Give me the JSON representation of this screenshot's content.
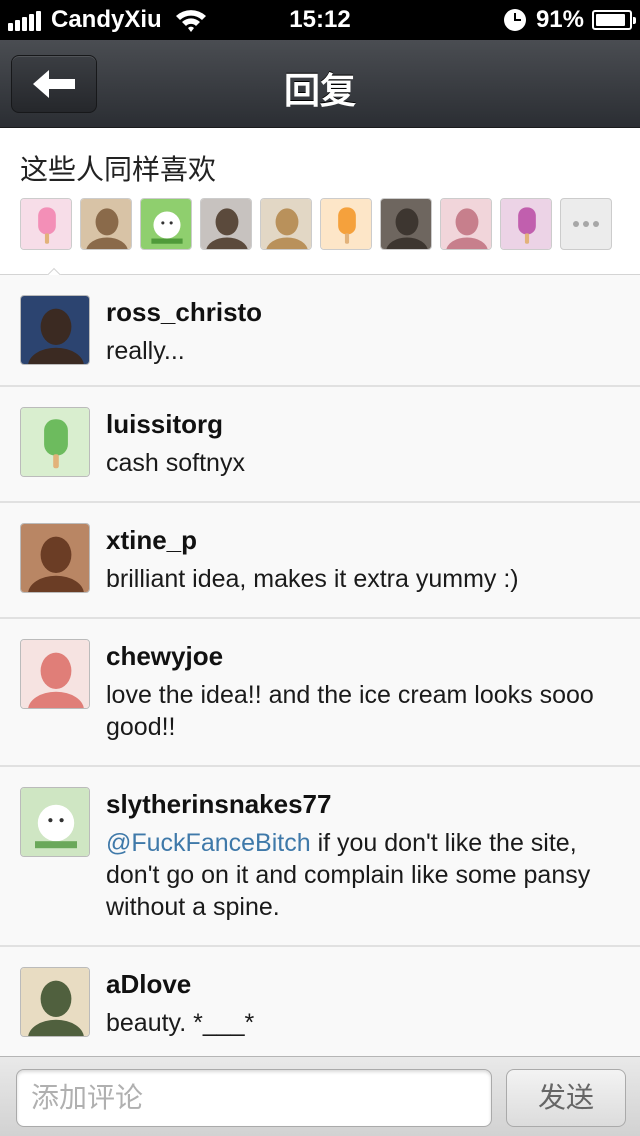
{
  "status_bar": {
    "carrier": "CandyXiu",
    "time": "15:12",
    "battery_text": "91%",
    "battery_level": 0.91
  },
  "nav": {
    "title": "回复",
    "back_icon": "back-arrow-icon"
  },
  "likes": {
    "title": "这些人同样喜欢",
    "avatars": [
      {
        "kind": "popsicle",
        "color": "#f38fb7",
        "bg": "#f7dde8"
      },
      {
        "kind": "photo",
        "color": "#8a6a4a",
        "bg": "#d8c3a6"
      },
      {
        "kind": "cartoon",
        "color": "#4f9a3a",
        "bg": "#8fcf6e"
      },
      {
        "kind": "photo",
        "color": "#5b4a3c",
        "bg": "#c7c2bf"
      },
      {
        "kind": "photo",
        "color": "#b9915b",
        "bg": "#e2d7c5"
      },
      {
        "kind": "popsicle",
        "color": "#f5a13c",
        "bg": "#fde6c8"
      },
      {
        "kind": "photo",
        "color": "#3d3630",
        "bg": "#6e665f"
      },
      {
        "kind": "photo",
        "color": "#c77f8c",
        "bg": "#f1d5da"
      },
      {
        "kind": "popsicle",
        "color": "#c15fae",
        "bg": "#ecd3e6"
      }
    ],
    "more_icon": "more-dots-icon"
  },
  "comments": [
    {
      "user": "ross_christo",
      "mention": "",
      "text": "really...",
      "avatar": {
        "kind": "photo",
        "color": "#3b2a22",
        "bg": "#2c4470"
      }
    },
    {
      "user": "luissitorg",
      "mention": "",
      "text": "cash softnyx",
      "avatar": {
        "kind": "popsicle",
        "color": "#6dbb5e",
        "bg": "#d9eecf"
      }
    },
    {
      "user": "xtine_p",
      "mention": "",
      "text": "brilliant idea, makes it extra yummy :)",
      "avatar": {
        "kind": "photo",
        "color": "#6b3d25",
        "bg": "#b98664"
      }
    },
    {
      "user": "chewyjoe",
      "mention": "",
      "text": "love the idea!! and the ice cream looks sooo good!!",
      "avatar": {
        "kind": "photo",
        "color": "#e07e78",
        "bg": "#f6e3e1"
      }
    },
    {
      "user": "slytherinsnakes77",
      "mention": "@FuckFanceBitch",
      "text": " if you don't like the site, don't go on it and complain like some pansy without a spine.",
      "avatar": {
        "kind": "cartoon",
        "color": "#6aa85a",
        "bg": "#cfe6c3"
      }
    },
    {
      "user": "aDlove",
      "mention": "",
      "text": "beauty.  *___*",
      "avatar": {
        "kind": "photo",
        "color": "#50603e",
        "bg": "#e8dcc2"
      }
    }
  ],
  "comment_bar": {
    "placeholder": "添加评论",
    "send_label": "发送"
  }
}
